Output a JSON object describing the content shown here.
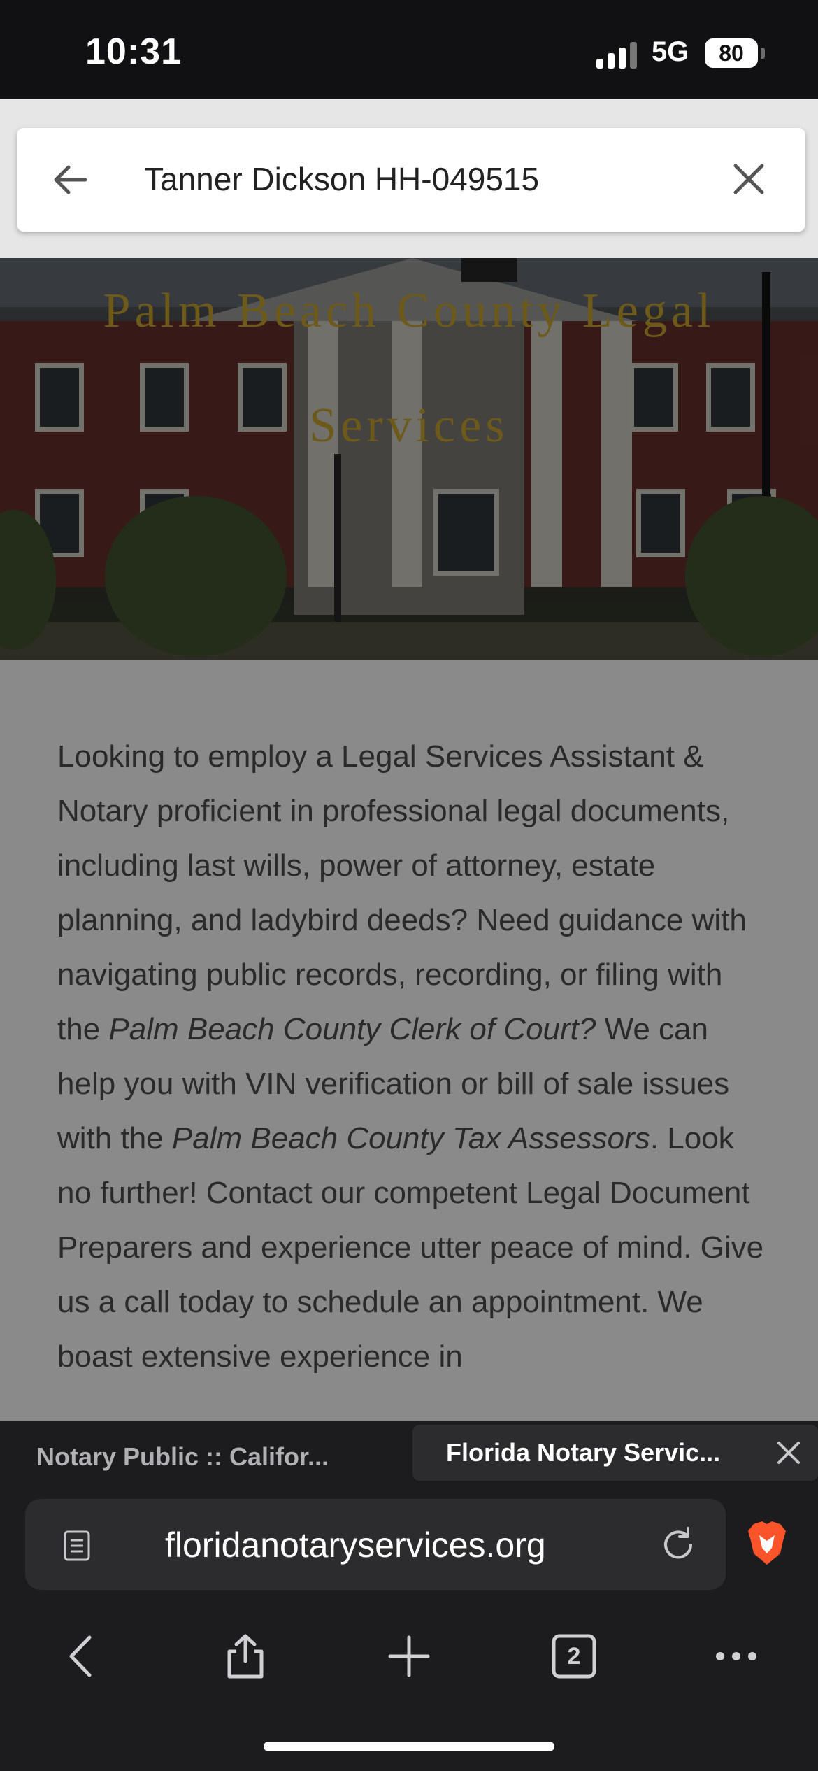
{
  "status_bar": {
    "time": "10:31",
    "network": "5G",
    "battery": "80"
  },
  "search": {
    "query": "Tanner Dickson HH-049515"
  },
  "hero": {
    "title_line1": "Palm Beach County Legal",
    "title_line2": "Services"
  },
  "content": {
    "p1": "Looking to employ a Legal Services Assistant & Notary proficient in professional legal documents, including last wills, power of attorney, estate planning, and ladybird deeds? Need guidance with navigating public records, recording, or filing with the ",
    "p1_italic1": "Palm Beach County Clerk of Court?",
    "p2": " We can help you with VIN verification or bill of sale issues with the ",
    "p2_italic": "Palm Beach County Tax Assessors",
    "p3": ". Look no further! Contact our competent Legal Document Preparers and experience utter peace of mind. Give us a call today to schedule an appointment. We boast extensive experience in"
  },
  "tabs": {
    "inactive_label": "Notary Public :: Califor...",
    "active_label": "Florida Notary Servic..."
  },
  "address_bar": {
    "url": "floridanotaryservices.org"
  },
  "toolbar": {
    "tab_count": "2"
  },
  "colors": {
    "hero_title": "#6d5a1a",
    "content_bg": "#8a8a8a",
    "brave_orange": "#fb542b"
  },
  "icons": [
    "back-arrow-icon",
    "close-icon",
    "reader-icon",
    "reload-icon",
    "brave-icon",
    "back-icon",
    "share-icon",
    "plus-icon",
    "tabs-icon",
    "more-icon"
  ]
}
